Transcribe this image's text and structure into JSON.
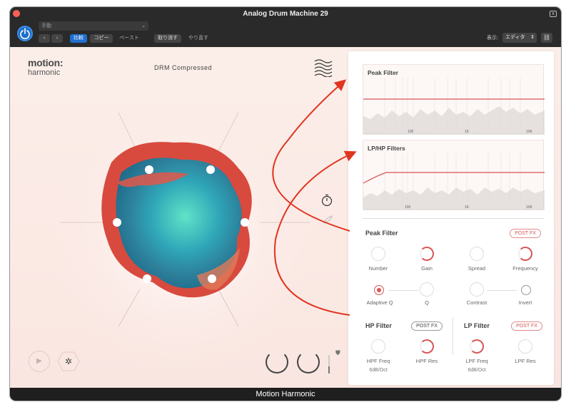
{
  "window": {
    "title": "Analog Drum Machine 29",
    "close_label": "x",
    "preset_value": "手動",
    "toolbar": {
      "back_label": "‹",
      "forward_label": "›",
      "compare_label": "比較",
      "copy_label": "コピー",
      "paste_label": "ペースト",
      "undo_label": "取り消す",
      "redo_label": "やり直す",
      "view_label": "表示:",
      "view_value": "エディタ"
    }
  },
  "plugin": {
    "logo_top": "motion:",
    "logo_bottom": "harmonic",
    "preset_name": "DRM Compressed",
    "peak_graph": {
      "title": "Peak Filter",
      "ticks": [
        "100",
        "1K",
        "10K"
      ]
    },
    "lphp_graph": {
      "title": "LP/HP Filters",
      "ticks": [
        "100",
        "1K",
        "10K"
      ]
    },
    "peak_section": {
      "label": "Peak Filter",
      "post_fx": "POST FX",
      "knobs": [
        "Number",
        "Gain",
        "Spread",
        "Frequency"
      ],
      "row2": [
        "Adaptive Q",
        "Q",
        "Contrast",
        "Invert"
      ]
    },
    "hp_section": {
      "label": "HP Filter",
      "post_fx": "POST FX",
      "freq_label": "HPF Freq",
      "res_label": "HPF Res",
      "slope": "6dB/Oct"
    },
    "lp_section": {
      "label": "LP Filter",
      "post_fx": "POST FX",
      "freq_label": "LPF Freq",
      "res_label": "LPF Res",
      "slope": "6dB/Oct"
    },
    "footer_title": "Motion Harmonic"
  },
  "colors": {
    "accent": "#d95555",
    "titlebar": "#2a2a2a",
    "annotation": "#e0351f"
  }
}
